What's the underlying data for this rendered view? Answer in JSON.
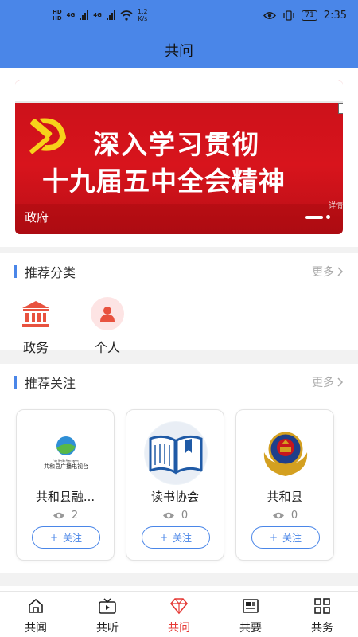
{
  "status_bar": {
    "hd1": "HD",
    "hd2": "HD",
    "net1": "4G",
    "net2": "4G",
    "speed_value": "1.2",
    "speed_unit": "K/s",
    "battery": "71",
    "time": "2:35"
  },
  "header": {
    "title": "共问"
  },
  "banner": {
    "line1": "深入学习贯彻",
    "line2": "十九届五中全会精神",
    "caption": "政府",
    "detail": "详情",
    "active_slide": 1,
    "slide_count": 2
  },
  "categories": {
    "title": "推荐分类",
    "more": "更多",
    "items": [
      {
        "label": "政务",
        "icon": "government-building-icon",
        "color": "#e8523f"
      },
      {
        "label": "个人",
        "icon": "person-icon",
        "color": "#e8523f"
      }
    ]
  },
  "follows": {
    "title": "推荐关注",
    "more": "更多",
    "cards": [
      {
        "name": "共和县融...",
        "views": "2",
        "follow": "关注",
        "logo_text": "共和县广播电视台",
        "logo_tibetan": "༄༅། ཁྲི་ཀ་རྫོང་གི་རྒྱང་བསྒྲགས།"
      },
      {
        "name": "读书协会",
        "views": "0",
        "follow": "关注"
      },
      {
        "name": "共和县",
        "views": "0",
        "follow": "关注"
      }
    ]
  },
  "tabbar": {
    "items": [
      {
        "label": "共闻",
        "icon": "home-icon"
      },
      {
        "label": "共听",
        "icon": "video-icon"
      },
      {
        "label": "共问",
        "icon": "diamond-icon",
        "active": true
      },
      {
        "label": "共要",
        "icon": "news-icon"
      },
      {
        "label": "共务",
        "icon": "grid-icon"
      }
    ]
  },
  "colors": {
    "header": "#4a86e8",
    "accent": "#e53935",
    "banner": "#d8141c"
  }
}
